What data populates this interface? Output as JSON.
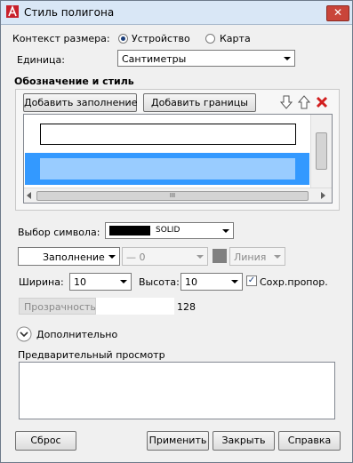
{
  "window": {
    "title": "Стиль полигона",
    "close_glyph": "✕"
  },
  "size_context": {
    "label": "Контекст размера:",
    "options": [
      {
        "label": "Устройство",
        "selected": true
      },
      {
        "label": "Карта",
        "selected": false
      }
    ]
  },
  "unit": {
    "label": "Единица:",
    "value": "Сантиметры"
  },
  "symbology": {
    "section_label": "Обозначение и стиль",
    "add_fill_label": "Добавить заполнение",
    "add_border_label": "Добавить границы",
    "hscroll_grip": "III"
  },
  "symbol_select": {
    "label": "Выбор символа:",
    "value": "SOLID",
    "swatch_color": "#000000"
  },
  "fill_row": {
    "fill_label": "Заполнение",
    "dash_value": "— 0",
    "line_label": "Линия",
    "line_color": "#808080"
  },
  "dimensions": {
    "width_label": "Ширина:",
    "width_value": "10",
    "height_label": "Высота:",
    "height_value": "10",
    "keep_ratio_label": "Сохр.пропор.",
    "keep_ratio_checked": true
  },
  "transparency": {
    "label": "Прозрачность",
    "value": "128"
  },
  "advanced": {
    "label": "Дополнительно"
  },
  "preview": {
    "label": "Предварительный просмотр"
  },
  "buttons": {
    "reset": "Сброс",
    "apply": "Применить",
    "close": "Закрыть",
    "help": "Справка"
  },
  "colors": {
    "selection": "#3399ff",
    "selection_inner": "#99ccff",
    "title_bg": "#d9e7f6"
  }
}
